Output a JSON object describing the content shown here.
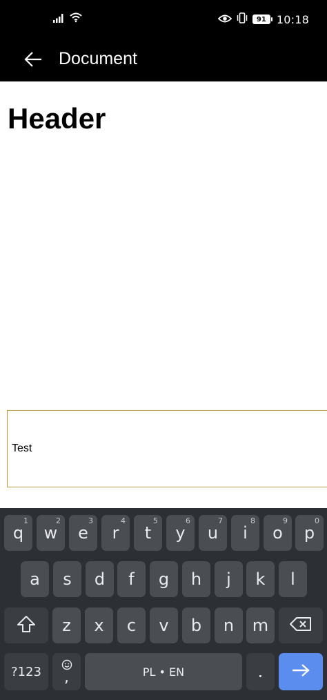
{
  "status_bar": {
    "time": "10:18",
    "battery": "91",
    "icons": [
      "signal-icon",
      "wifi-icon",
      "eye-icon",
      "vibrate-icon",
      "battery-icon"
    ]
  },
  "app_bar": {
    "title": "Document",
    "back_icon": "back-arrow-icon"
  },
  "content": {
    "header": "Header",
    "field_value": "Test"
  },
  "keyboard": {
    "row1": [
      {
        "key": "q",
        "hint": "1"
      },
      {
        "key": "w",
        "hint": "2"
      },
      {
        "key": "e",
        "hint": "3"
      },
      {
        "key": "r",
        "hint": "4"
      },
      {
        "key": "t",
        "hint": "5"
      },
      {
        "key": "y",
        "hint": "6"
      },
      {
        "key": "u",
        "hint": "7"
      },
      {
        "key": "i",
        "hint": "8"
      },
      {
        "key": "o",
        "hint": "9"
      },
      {
        "key": "p",
        "hint": "0"
      }
    ],
    "row2": [
      "a",
      "s",
      "d",
      "f",
      "g",
      "h",
      "j",
      "k",
      "l"
    ],
    "row3": [
      "z",
      "x",
      "c",
      "v",
      "b",
      "n",
      "m"
    ],
    "shift_icon": "shift-icon",
    "backspace_icon": "backspace-icon",
    "symbols_label": "?123",
    "comma_label": ",",
    "emoji_icon": "emoji-icon",
    "space_label": "PL • EN",
    "period_label": ".",
    "enter_icon": "enter-arrow-icon",
    "colors": {
      "background": "#2c2f33",
      "key": "#4a4d52",
      "enter": "#5b8def"
    }
  },
  "colors": {
    "app_bar": "#000000",
    "field_border": "#b89a3a"
  }
}
